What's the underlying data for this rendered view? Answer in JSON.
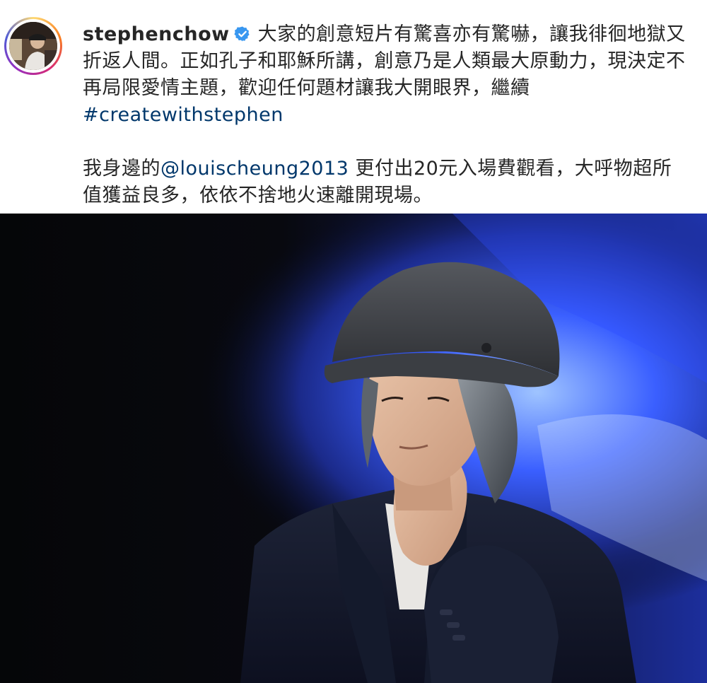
{
  "post": {
    "username": "stephenchow",
    "verified": true,
    "caption": {
      "line1_text": "大家的創意短片有驚喜亦有驚嚇，讓我徘徊地獄又折返人間。正如孔子和耶穌所講，創意乃是人類最大原動力，現決定不再局限愛情主題，歡迎任何題材讓我大開眼界，繼續",
      "hashtag": "#createwithstephen",
      "line2_prefix": "我身邊的",
      "mention": "@louischeung2013",
      "line2_suffix": " 更付出20元入場費觀看，大呼物超所值獲益良多，依依不捨地火速離開現場。"
    },
    "colors": {
      "text": "#262626",
      "link": "#00376b",
      "verified_badge": "#3897f0"
    }
  },
  "icons": {
    "verified": "verified-badge-icon",
    "avatar": "profile-avatar"
  }
}
